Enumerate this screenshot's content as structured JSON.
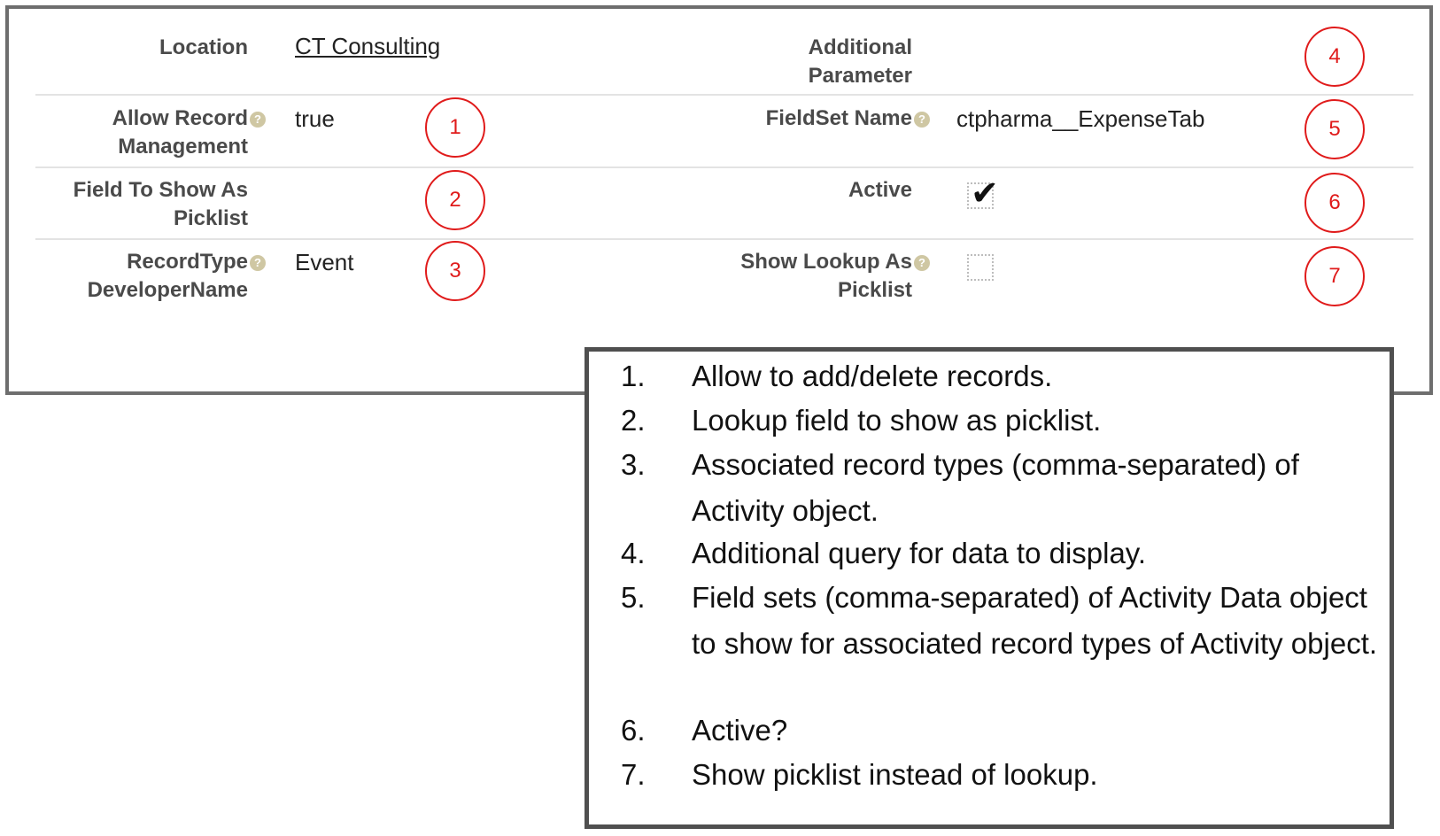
{
  "form": {
    "location_label": "Location",
    "location_value": "CT Consulting",
    "additional_parameter_label_line1": "Additional",
    "additional_parameter_label_line2": "Parameter",
    "allow_record_label_line1": "Allow Record",
    "allow_record_label_line2": "Management",
    "allow_record_value": "true",
    "fieldset_label": "FieldSet Name",
    "fieldset_value": "ctpharma__ExpenseTab",
    "field_picklist_label_line1": "Field To Show As",
    "field_picklist_label_line2": "Picklist",
    "active_label": "Active",
    "active_checked": true,
    "recordtype_label_line1": "RecordType",
    "recordtype_label_line2": "DeveloperName",
    "recordtype_value": "Event",
    "show_lookup_label_line1": "Show Lookup As",
    "show_lookup_label_line2": "Picklist",
    "show_lookup_checked": false,
    "help_icon": "help-icon"
  },
  "markers": {
    "m1": "1",
    "m2": "2",
    "m3": "3",
    "m4": "4",
    "m5": "5",
    "m6": "6",
    "m7": "7"
  },
  "legend": {
    "items": [
      {
        "num": "1.",
        "text": "Allow to add/delete records."
      },
      {
        "num": "2.",
        "text": "Lookup field to show as picklist."
      },
      {
        "num": "3.",
        "text": "Associated record types (comma-separated) of Activity object."
      },
      {
        "num": "4.",
        "text": "Additional query for data to display."
      },
      {
        "num": "5.",
        "text": "Field sets (comma-separated) of Activity Data object to show for associated record types of Activity object."
      },
      {
        "num": "6.",
        "text": "Active?"
      },
      {
        "num": "7.",
        "text": "Show picklist instead of lookup."
      }
    ]
  },
  "colors": {
    "marker": "#e01b1b",
    "label": "#4a4a4a",
    "border": "#6e6e6e"
  }
}
